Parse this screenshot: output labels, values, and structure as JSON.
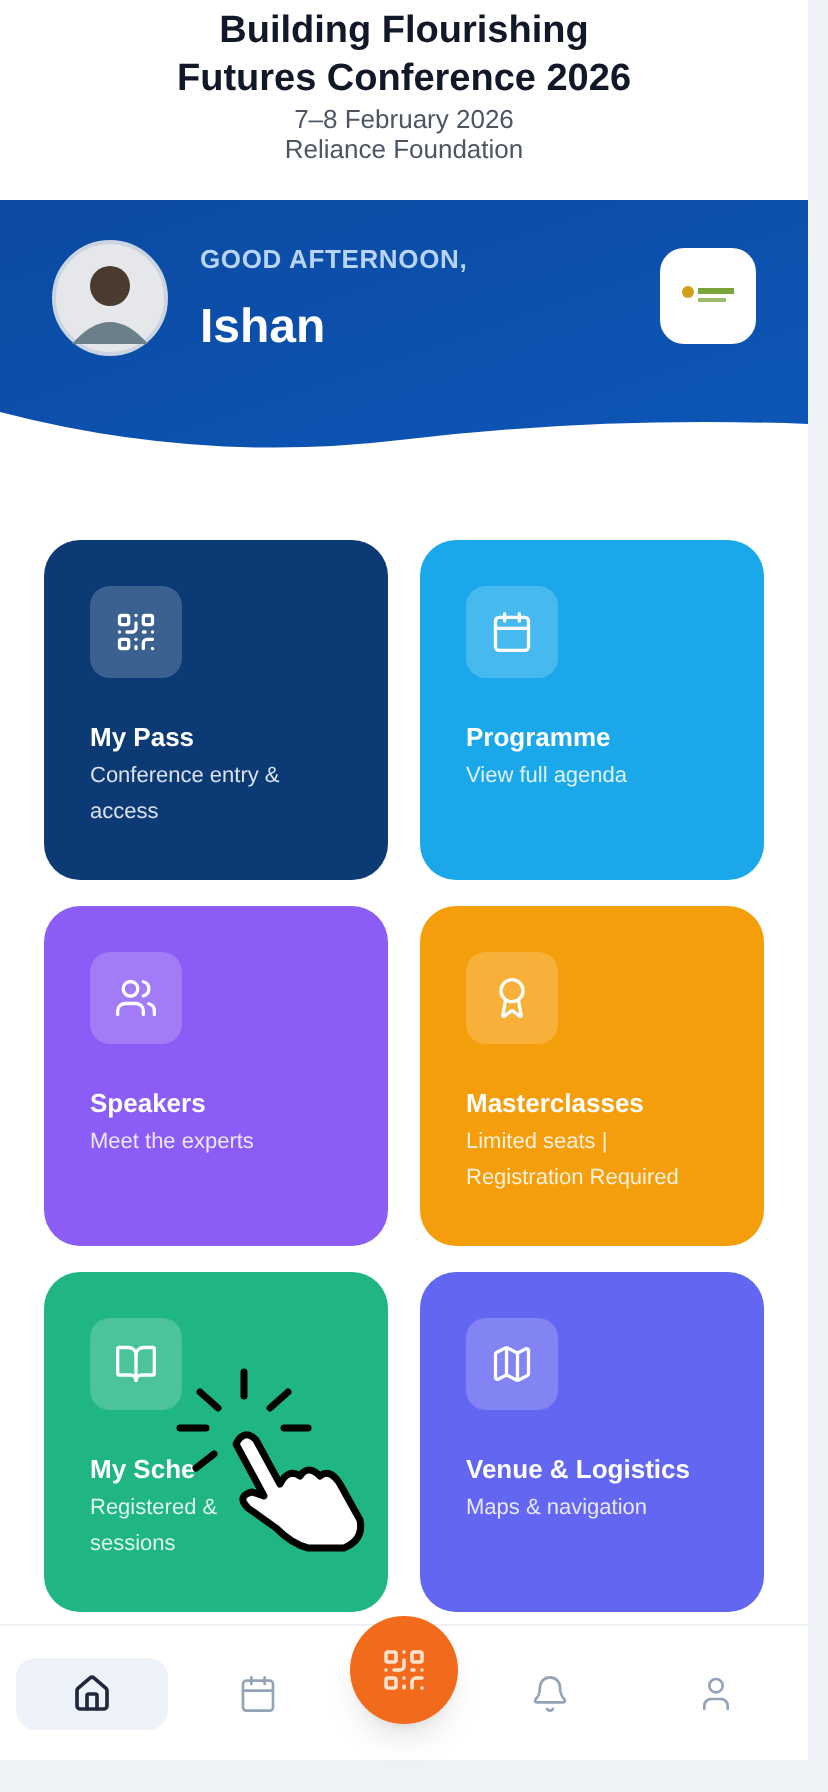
{
  "header": {
    "title_lines": [
      "Building Flourishing",
      "Futures Conference 2026"
    ],
    "date": "7–8 February 2026",
    "organizer": "Reliance Foundation"
  },
  "banner": {
    "greeting": "GOOD AFTERNOON,",
    "name": "Ishan"
  },
  "cards": [
    {
      "kind": "pass",
      "color": "#0b3a75",
      "title": "My Pass",
      "lines": [
        "Conference entry &",
        "access"
      ]
    },
    {
      "kind": "calendar",
      "color": "#1ba8ea",
      "title": "Programme",
      "lines": [
        "View full agenda"
      ]
    },
    {
      "kind": "people",
      "color": "#8b5cf6",
      "title": "Speakers",
      "lines": [
        "Meet the experts"
      ]
    },
    {
      "kind": "award",
      "color": "#f59e0b",
      "title": "Masterclasses",
      "lines": [
        "Limited seats |",
        "Registration Required"
      ]
    },
    {
      "kind": "book",
      "color": "#1fb584",
      "title": "My Sche",
      "lines": [
        "Registered &",
        "sessions"
      ],
      "pointer": true
    },
    {
      "kind": "map",
      "color": "#6366f1",
      "title": "Venue & Logistics",
      "lines": [
        "Maps & navigation"
      ]
    }
  ],
  "nav": [
    {
      "kind": "home",
      "selected": true
    },
    {
      "kind": "calendar",
      "selected": false
    },
    {
      "kind": "scan",
      "selected": false
    },
    {
      "kind": "bell",
      "selected": false
    },
    {
      "kind": "user",
      "selected": false
    }
  ]
}
